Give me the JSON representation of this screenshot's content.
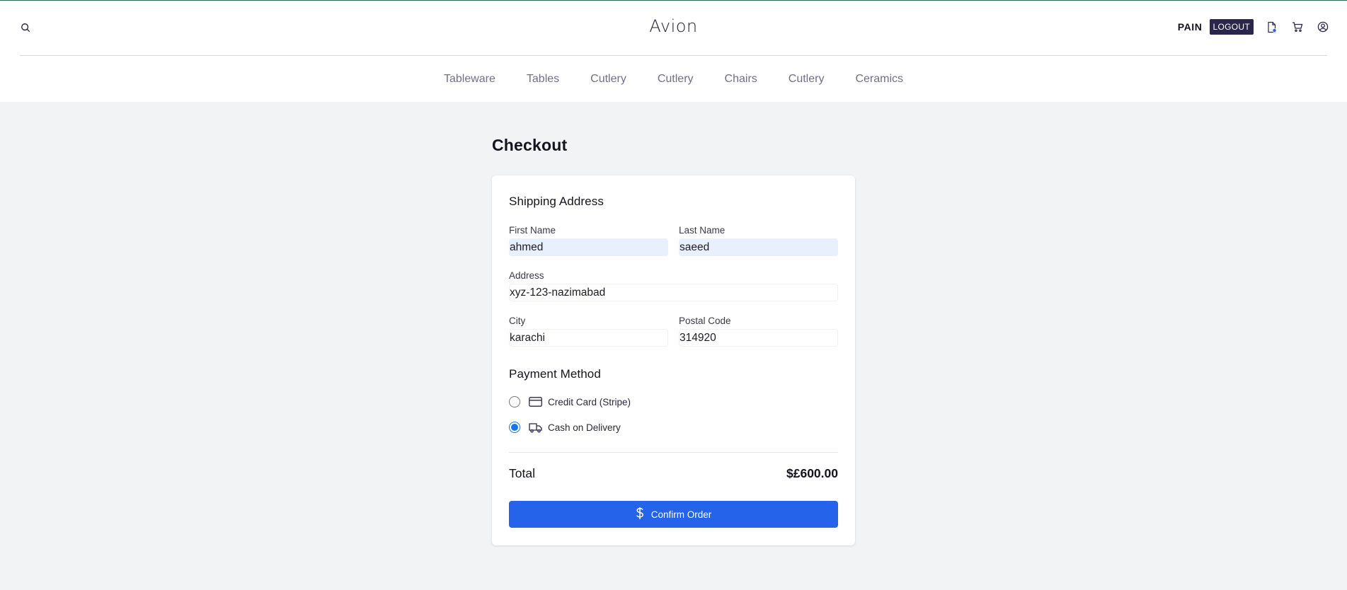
{
  "header": {
    "brand": "Avion",
    "user_name": "PAIN",
    "logout_label": "LOGOUT",
    "icons": [
      "search-icon",
      "orders-icon",
      "cart-icon",
      "user-icon"
    ]
  },
  "nav": {
    "items": [
      "Tableware",
      "Tables",
      "Cutlery",
      "Cutlery",
      "Chairs",
      "Cutlery",
      "Ceramics"
    ]
  },
  "checkout": {
    "title": "Checkout",
    "shipping": {
      "title": "Shipping Address",
      "first_name_label": "First Name",
      "first_name_value": "ahmed",
      "last_name_label": "Last Name",
      "last_name_value": "saeed",
      "address_label": "Address",
      "address_value": "xyz-123-nazimabad",
      "city_label": "City",
      "city_value": "karachi",
      "postal_label": "Postal Code",
      "postal_value": "314920"
    },
    "payment": {
      "title": "Payment Method",
      "options": [
        {
          "label": "Credit Card (Stripe)",
          "icon": "credit-card-icon",
          "selected": false
        },
        {
          "label": "Cash on Delivery",
          "icon": "truck-icon",
          "selected": true
        }
      ]
    },
    "total_label": "Total",
    "total_value": "$£600.00",
    "confirm_label": "Confirm Order"
  },
  "colors": {
    "accent": "#2563eb",
    "logout_bg": "#2a254b",
    "nav_text": "#726e8d",
    "page_bg": "#f2f3f5",
    "autofill_bg": "#e8f0fe"
  }
}
